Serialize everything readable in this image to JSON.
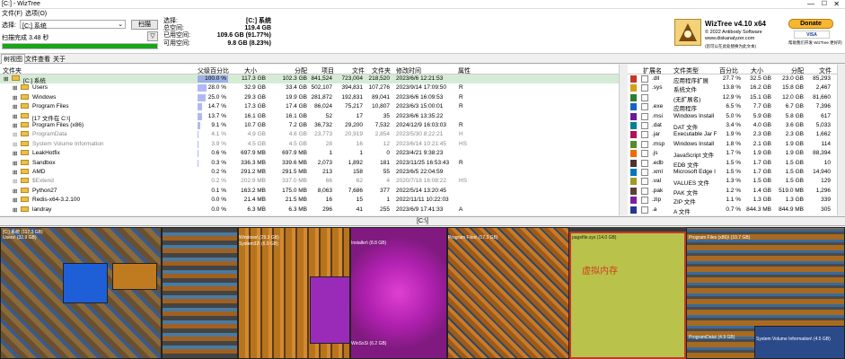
{
  "window": {
    "title": "[C:] - WizTree"
  },
  "menu": [
    "文件(F)",
    "选项(O)"
  ],
  "select": {
    "label": "选择:",
    "drive_value": "[C:] 系统",
    "scan_label": "扫描"
  },
  "scan": {
    "status": "扫描完成 3.48 秒",
    "filter_icon": "filter-icon"
  },
  "stats": {
    "selected_label": "选择:",
    "selected_value": "[C:] 系统",
    "total_label": "总空间:",
    "total_value": "119.4 GB",
    "used_label": "已用空间:",
    "used_value": "109.6 GB (91.77%)",
    "free_label": "可用空间:",
    "free_value": "9.8 GB (8.23%)"
  },
  "brand": {
    "name": "WizTree v4.10 x64",
    "copyright": "© 2022 Antibody Software",
    "site": "www.diskanalyzer.com",
    "note": "(您可以在此处替换为此文本)"
  },
  "donate": {
    "label": "Donate",
    "sub": "帮助我们开发 WizTree 更好的"
  },
  "tabs": [
    "树视图",
    "文件查看",
    "关于"
  ],
  "tree_columns": [
    "文件夹",
    "父级百分比",
    "大小",
    "分配",
    "项目",
    "文件",
    "文件夹",
    "修改时间",
    "属性"
  ],
  "tree_rows": [
    {
      "name": "[C:] 系统",
      "pct": "100.0 %",
      "pct_value": 100,
      "size": "117.3 GB",
      "alloc": "102.3 GB",
      "items": "841,524",
      "files": "723,004",
      "folders": "218,520",
      "modified": "2023/6/6 12:21:53",
      "attr": "",
      "indent": 0,
      "gray": false,
      "selected": true
    },
    {
      "name": "Users",
      "pct": "28.0 %",
      "pct_value": 28,
      "size": "32.9 GB",
      "alloc": "33.4 GB",
      "items": "502,107",
      "files": "394,831",
      "folders": "107,276",
      "modified": "2023/9/14 17:09:50",
      "attr": "R",
      "indent": 1,
      "gray": false,
      "selected": false
    },
    {
      "name": "Windows",
      "pct": "25.0 %",
      "pct_value": 25,
      "size": "29.3 GB",
      "alloc": "19.9 GB",
      "items": "281,872",
      "files": "192,831",
      "folders": "89,041",
      "modified": "2023/6/6 16:09:53",
      "attr": "R",
      "indent": 1,
      "gray": false,
      "selected": false
    },
    {
      "name": "Program Files",
      "pct": "14.7 %",
      "pct_value": 14.7,
      "size": "17.3 GB",
      "alloc": "17.4 GB",
      "items": "86,024",
      "files": "75,217",
      "folders": "10,807",
      "modified": "2023/6/3 15:00:01",
      "attr": "R",
      "indent": 1,
      "gray": false,
      "selected": false
    },
    {
      "name": "[17 文件在 C:\\]",
      "pct": "13.7 %",
      "pct_value": 13.7,
      "size": "16.1 GB",
      "alloc": "16.1 GB",
      "items": "52",
      "files": "17",
      "folders": "35",
      "modified": "2023/6/6 13:35:22",
      "attr": "",
      "indent": 1,
      "gray": false,
      "selected": false
    },
    {
      "name": "Program Files (x86)",
      "pct": "9.1 %",
      "pct_value": 9.1,
      "size": "10.7 GB",
      "alloc": "7.2 GB",
      "items": "36,732",
      "files": "29,200",
      "folders": "7,532",
      "modified": "2024/12/9 16:03:03",
      "attr": "R",
      "indent": 1,
      "gray": false,
      "selected": false
    },
    {
      "name": "ProgramData",
      "pct": "4.1 %",
      "pct_value": 4.1,
      "size": "4.9 GB",
      "alloc": "4.6 GB",
      "items": "23,773",
      "files": "20,919",
      "folders": "2,854",
      "modified": "2023/5/30 8:22:21",
      "attr": "H",
      "indent": 1,
      "gray": true,
      "selected": false
    },
    {
      "name": "System Volume Information",
      "pct": "3.9 %",
      "pct_value": 3.9,
      "size": "4.5 GB",
      "alloc": "4.5 GB",
      "items": "28",
      "files": "16",
      "folders": "12",
      "modified": "2023/6/14 10:21:45",
      "attr": "HS",
      "indent": 1,
      "gray": true,
      "selected": false
    },
    {
      "name": "LeakHotfix",
      "pct": "0.6 %",
      "pct_value": 0.6,
      "size": "697.9 MB",
      "alloc": "697.9 MB",
      "items": "1",
      "files": "1",
      "folders": "0",
      "modified": "2023/4/21 9:38:23",
      "attr": "",
      "indent": 1,
      "gray": false,
      "selected": false
    },
    {
      "name": "Sandbox",
      "pct": "0.3 %",
      "pct_value": 0.3,
      "size": "336.3 MB",
      "alloc": "339.6 MB",
      "items": "2,073",
      "files": "1,892",
      "folders": "181",
      "modified": "2023/11/25 16:53:43",
      "attr": "R",
      "indent": 1,
      "gray": false,
      "selected": false
    },
    {
      "name": "AMD",
      "pct": "0.2 %",
      "pct_value": 0.2,
      "size": "291.2 MB",
      "alloc": "291.5 MB",
      "items": "213",
      "files": "158",
      "folders": "55",
      "modified": "2023/6/5 22:04:59",
      "attr": "",
      "indent": 1,
      "gray": false,
      "selected": false
    },
    {
      "name": "$Extend",
      "pct": "0.2 %",
      "pct_value": 0.2,
      "size": "202.9 MB",
      "alloc": "337.0 MB",
      "items": "66",
      "files": "62",
      "folders": "4",
      "modified": "2020/7/18 16:08:22",
      "attr": "HS",
      "indent": 1,
      "gray": true,
      "selected": false
    },
    {
      "name": "Python27",
      "pct": "0.1 %",
      "pct_value": 0.1,
      "size": "163.2 MB",
      "alloc": "175.0 MB",
      "items": "8,063",
      "files": "7,686",
      "folders": "377",
      "modified": "2022/5/14 13:20:45",
      "attr": "",
      "indent": 1,
      "gray": false,
      "selected": false
    },
    {
      "name": "Redis-x64-3.2.100",
      "pct": "0.0 %",
      "pct_value": 0,
      "size": "21.4 MB",
      "alloc": "21.5 MB",
      "items": "16",
      "files": "15",
      "folders": "1",
      "modified": "2022/11/11 10:22:03",
      "attr": "",
      "indent": 1,
      "gray": false,
      "selected": false
    },
    {
      "name": "landray",
      "pct": "0.0 %",
      "pct_value": 0,
      "size": "6.3 MB",
      "alloc": "6.3 MB",
      "items": "296",
      "files": "41",
      "folders": "255",
      "modified": "2023/6/9 17:41:33",
      "attr": "A",
      "indent": 1,
      "gray": false,
      "selected": false
    }
  ],
  "ext_columns": [
    "扩展名",
    "文件类型",
    "百分比",
    "大小",
    "分配",
    "文件"
  ],
  "ext_rows": [
    {
      "ext": ".dll",
      "type": "应用程序扩展",
      "pct": "27.7 %",
      "size": "32.5 GB",
      "alloc": "23.0 GB",
      "files": "85,293",
      "color": "#c0392b"
    },
    {
      "ext": ".sys",
      "type": "系统文件",
      "pct": "13.8 %",
      "size": "16.2 GB",
      "alloc": "15.8 GB",
      "files": "2,467",
      "color": "#d4a017"
    },
    {
      "ext": "",
      "type": "(无扩展名)",
      "pct": "12.9 %",
      "size": "15.1 GB",
      "alloc": "12.0 GB",
      "files": "81,660",
      "color": "#2e7d32"
    },
    {
      "ext": ".exe",
      "type": "应用程序",
      "pct": "6.5 %",
      "size": "7.7 GB",
      "alloc": "6.7 GB",
      "files": "7,396",
      "color": "#1565c0"
    },
    {
      "ext": ".msi",
      "type": "Windows Install",
      "pct": "5.0 %",
      "size": "5.9 GB",
      "alloc": "5.8 GB",
      "files": "617",
      "color": "#6a1b9a"
    },
    {
      "ext": ".dat",
      "type": "DAT 文件",
      "pct": "3.4 %",
      "size": "4.0 GB",
      "alloc": "3.6 GB",
      "files": "5,033",
      "color": "#00838f"
    },
    {
      "ext": ".jar",
      "type": "Executable Jar Fi",
      "pct": "1.9 %",
      "size": "2.3 GB",
      "alloc": "2.3 GB",
      "files": "1,662",
      "color": "#ad1457"
    },
    {
      "ext": ".msp",
      "type": "Windows Install",
      "pct": "1.8 %",
      "size": "2.1 GB",
      "alloc": "1.9 GB",
      "files": "114",
      "color": "#558b2f"
    },
    {
      "ext": ".js",
      "type": "JavaScript 文件",
      "pct": "1.7 %",
      "size": "1.9 GB",
      "alloc": "1.9 GB",
      "files": "88,394",
      "color": "#ef6c00"
    },
    {
      "ext": ".edb",
      "type": "EDB 文件",
      "pct": "1.5 %",
      "size": "1.7 GB",
      "alloc": "1.5 GB",
      "files": "10",
      "color": "#4e342e"
    },
    {
      "ext": ".xml",
      "type": "Microsoft Edge I",
      "pct": "1.5 %",
      "size": "1.7 GB",
      "alloc": "1.5 GB",
      "files": "14,940",
      "color": "#0277bd"
    },
    {
      "ext": ".val",
      "type": "VALUES 文件",
      "pct": "1.3 %",
      "size": "1.5 GB",
      "alloc": "1.5 GB",
      "files": "129",
      "color": "#9e9d24"
    },
    {
      "ext": ".pak",
      "type": "PAK 文件",
      "pct": "1.2 %",
      "size": "1.4 GB",
      "alloc": "519.0 MB",
      "files": "1,296",
      "color": "#5d4037"
    },
    {
      "ext": ".zip",
      "type": "ZIP 文件",
      "pct": "1.1 %",
      "size": "1.3 GB",
      "alloc": "1.3 GB",
      "files": "339",
      "color": "#7b1fa2"
    },
    {
      "ext": ".a",
      "type": "A 文件",
      "pct": "0.7 %",
      "size": "844.3 MB",
      "alloc": "844.9 MB",
      "files": "305",
      "color": "#283593"
    }
  ],
  "path_bar": "[C:\\]",
  "treemap_labels": {
    "root": "[C:] 系统 (117.3 GB)",
    "users": "Users\\ (32.9 GB)",
    "windows": "Windows\\ (29.3 GB)",
    "installer": "Installer\\ (8.8 GB)",
    "program_files": "Program Files\\ (17.3 GB)",
    "pagefile": "pagefile.sys (14.0 GB)",
    "virtual_memory": "虚拟内存",
    "program_files_x86": "Program Files (x86)\\ (10.7 GB)",
    "winsxs": "WinSxS\\ (6.2 GB)",
    "system32": "System32\\ (6.9 GB)",
    "program_data": "ProgramData\\ (4.9 GB)",
    "svi": "System Volume Information\\ (4.5 GB)"
  }
}
